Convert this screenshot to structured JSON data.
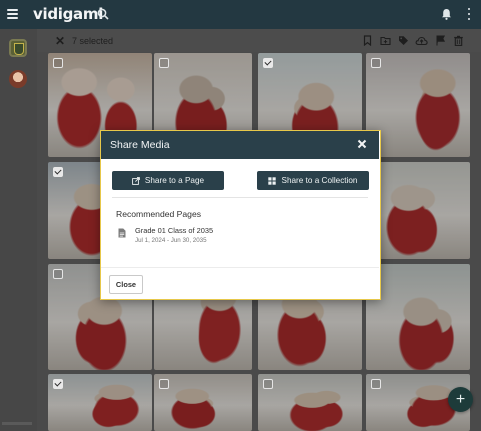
{
  "app": {
    "logo_text": "vidigami"
  },
  "selection": {
    "count_label": "7 selected"
  },
  "toolbar": {
    "icons": [
      "bookmark-icon",
      "add-folder-icon",
      "tag-icon",
      "cloud-upload-icon",
      "flag-icon",
      "trash-icon"
    ]
  },
  "tiles": [
    {
      "checked": false,
      "tone": [
        "#c9b7a5",
        "#e9d9cb",
        "#b12d2d"
      ]
    },
    {
      "checked": false,
      "tone": [
        "#d7d0c7",
        "#c6b8a8",
        "#a62a2a"
      ]
    },
    {
      "checked": true,
      "tone": [
        "#cdd7d8",
        "#d8c6b5",
        "#a92c2c"
      ]
    },
    {
      "checked": false,
      "tone": [
        "#c8c3c1",
        "#d6c2ae",
        "#aa2d2f"
      ]
    },
    {
      "checked": true,
      "tone": [
        "#aeb9c0",
        "#d9c9b6",
        "#b02d2d"
      ]
    },
    {
      "checked": false,
      "tone": [
        "#c6c0b6",
        "#d9cbbd",
        "#b12f2e"
      ]
    },
    {
      "checked": false,
      "tone": [
        "#c5c8c8",
        "#dacdbf",
        "#ab2b2a"
      ]
    },
    {
      "checked": false,
      "tone": [
        "#cfd1cb",
        "#dccfc1",
        "#ac2c2c"
      ]
    },
    {
      "checked": false,
      "tone": [
        "#c7c9c7",
        "#d9c8b6",
        "#a9292b"
      ]
    },
    {
      "checked": false,
      "tone": [
        "#cdd0cc",
        "#d6c6b5",
        "#b02e2e"
      ]
    },
    {
      "checked": false,
      "tone": [
        "#ccc8c2",
        "#dac9b5",
        "#ab2b2b"
      ]
    },
    {
      "checked": false,
      "tone": [
        "#c4ccc9",
        "#d4c7b7",
        "#a92b2d"
      ]
    },
    {
      "checked": true,
      "tone": [
        "#c3cacb",
        "#d8c7b6",
        "#b02c2c"
      ]
    },
    {
      "checked": false,
      "tone": [
        "#cbc5bd",
        "#dbc9b6",
        "#a82a2a"
      ]
    },
    {
      "checked": false,
      "tone": [
        "#c9cbc6",
        "#d9c7b2",
        "#b02e2e"
      ]
    },
    {
      "checked": false,
      "tone": [
        "#c5c6c3",
        "#d7c6b4",
        "#ab2c2c"
      ]
    }
  ],
  "dialog": {
    "title": "Share Media",
    "share_page_label": "Share to a Page",
    "share_collection_label": "Share to a Collection",
    "recommended_heading": "Recommended Pages",
    "recommended": [
      {
        "name": "Grade 01 Class of 2035",
        "dates": "Jul 1, 2024 - Jun 30, 2035"
      }
    ],
    "close_label": "Close"
  },
  "fab": {
    "label": "+"
  },
  "colors": {
    "appbar": "#233841",
    "dialog_header": "#2a404a",
    "dialog_border": "#e7c84a",
    "fab": "#1d3b3a"
  }
}
